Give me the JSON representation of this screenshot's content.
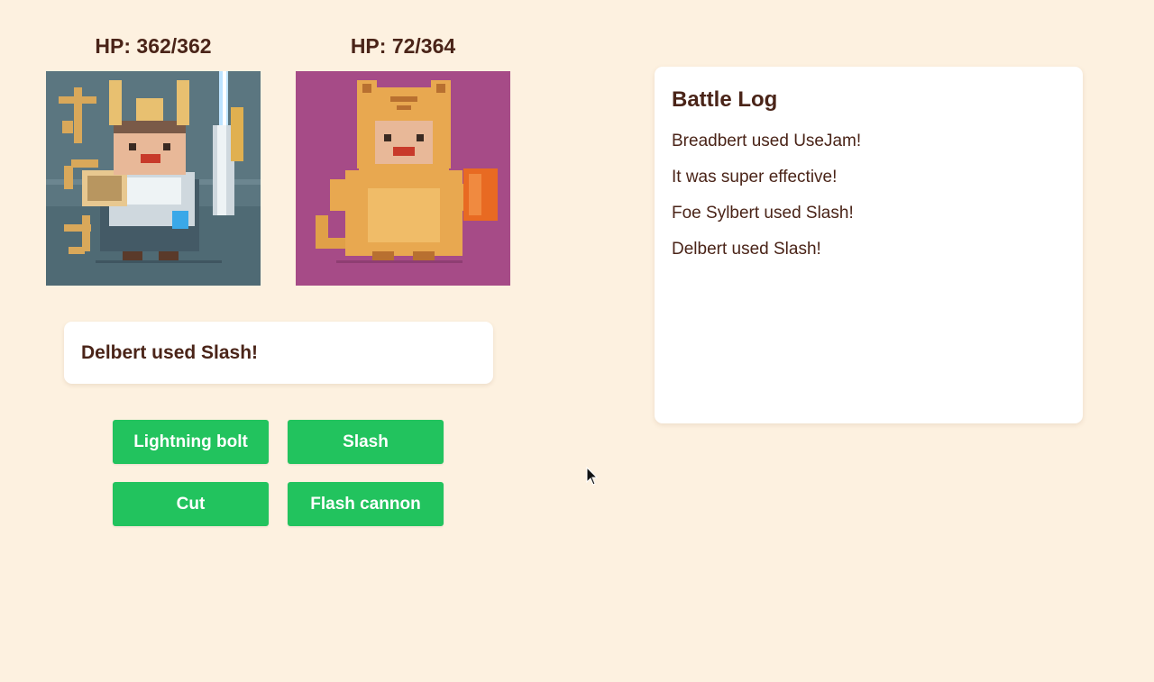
{
  "player": {
    "hp_text": "HP: 362/362",
    "hp_current": 362,
    "hp_max": 362
  },
  "foe": {
    "hp_text": "HP: 72/364",
    "hp_current": 72,
    "hp_max": 364
  },
  "sprites": {
    "player_icon": "armored-warrior-sprite",
    "foe_icon": "cat-costume-sprite",
    "player_bg": "#5b7680",
    "foe_bg": "#a64b87"
  },
  "message": {
    "text": "Delbert used Slash!"
  },
  "moves": [
    {
      "label": "Lightning bolt"
    },
    {
      "label": "Slash"
    },
    {
      "label": "Cut"
    },
    {
      "label": "Flash cannon"
    }
  ],
  "battle_log": {
    "title": "Battle Log",
    "entries": [
      "Breadbert used UseJam!",
      "It was super effective!",
      "Foe Sylbert used Slash!",
      "Delbert used Slash!"
    ]
  },
  "colors": {
    "background": "#fdf1e0",
    "button": "#22c35e",
    "text": "#4a2418"
  }
}
